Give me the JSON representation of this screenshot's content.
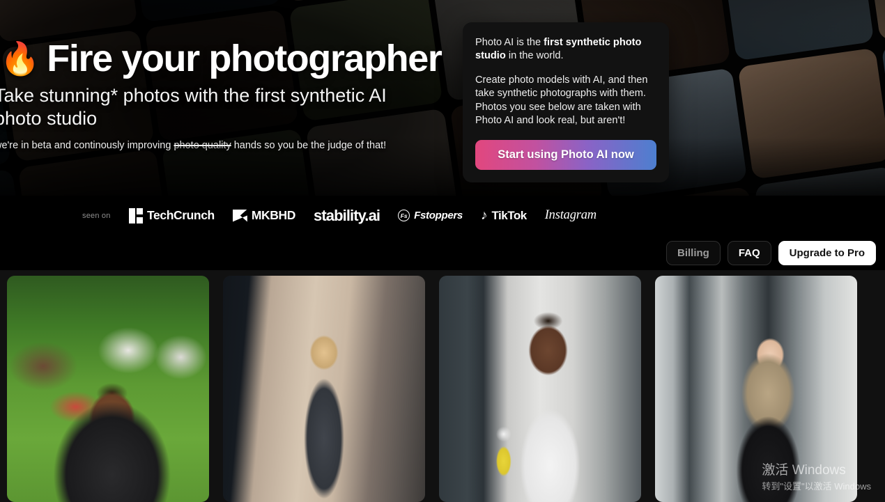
{
  "hero": {
    "emoji_icon": "fire-emoji",
    "emoji": "🔥",
    "headline": "Fire your photographer",
    "subheadline": "Take stunning* photos with the first synthetic AI photo studio",
    "note_prefix": "we're in beta and continously improving ",
    "note_struck": "photo quality",
    "note_suffix": " hands so you be the judge of that!"
  },
  "info_card": {
    "paragraph1_a": "Photo AI is the ",
    "paragraph1_bold": "first synthetic photo studio",
    "paragraph1_b": " in the world.",
    "paragraph2": "Create photo models with AI, and then take synthetic photographs with them. Photos you see below are taken with Photo AI and look real, but aren't!",
    "cta_label": "Start using Photo AI now",
    "cta_gradient_from": "#e2477e",
    "cta_gradient_to": "#4d7fcf",
    "background": "#121212"
  },
  "press": {
    "seen_on_label": "seen on",
    "logos": [
      {
        "name": "techcrunch",
        "text": "TechCrunch"
      },
      {
        "name": "mkbhd",
        "text": "MKBHD"
      },
      {
        "name": "stability-ai",
        "text": "stability.ai"
      },
      {
        "name": "fstoppers",
        "text": "Fstoppers",
        "mark": "Fs"
      },
      {
        "name": "tiktok",
        "text": "TikTok",
        "mark": "♪"
      },
      {
        "name": "instagram",
        "text": "Instagram"
      }
    ]
  },
  "nav": {
    "billing_label": "Billing",
    "faq_label": "FAQ",
    "upgrade_label": "Upgrade to Pro",
    "upgrade_bg": "#ffffff"
  },
  "gallery": {
    "photos": [
      {
        "name": "photo-card-man-park",
        "alt": "Smiling man in black t-shirt sitting on grass with picnic in background"
      },
      {
        "name": "photo-card-woman-coat",
        "alt": "Blonde woman in grey overcoat and white shirt on a city street"
      },
      {
        "name": "photo-card-man-tee",
        "alt": "Man in white t-shirt holding a yellow water bottle against a wall"
      },
      {
        "name": "photo-card-woman-black",
        "alt": "Woman with long blonde hair wearing a black high-neck blouse"
      }
    ]
  },
  "watermark": {
    "line1": "激活 Windows",
    "line2": "转到\"设置\"以激活 Windows"
  }
}
